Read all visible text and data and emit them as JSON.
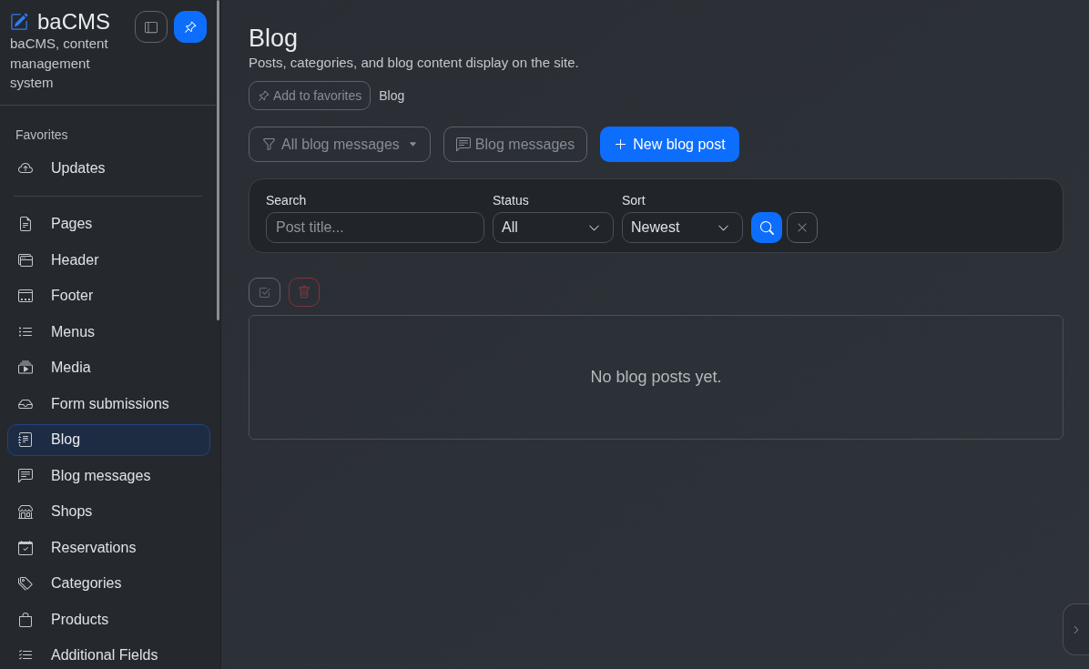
{
  "sidebar": {
    "brand": {
      "name": "baCMS",
      "tagline": "baCMS, content management system"
    },
    "pinned": true,
    "favorites_label": "Favorites",
    "favorites": [
      {
        "label": "Updates",
        "selected": false
      }
    ],
    "items": [
      {
        "label": "Pages",
        "selected": false
      },
      {
        "label": "Header",
        "selected": false
      },
      {
        "label": "Footer",
        "selected": false
      },
      {
        "label": "Menus",
        "selected": false
      },
      {
        "label": "Media",
        "selected": false
      },
      {
        "label": "Form submissions",
        "selected": false
      },
      {
        "label": "Blog",
        "selected": true
      },
      {
        "label": "Blog messages",
        "selected": false
      },
      {
        "label": "Shops",
        "selected": false
      },
      {
        "label": "Reservations",
        "selected": false
      },
      {
        "label": "Categories",
        "selected": false
      },
      {
        "label": "Products",
        "selected": false
      },
      {
        "label": "Additional Fields",
        "selected": false
      }
    ]
  },
  "page": {
    "title": "Blog",
    "subtitle": "Posts, categories, and blog content display on the site.",
    "favorite_button": "Add to favorites",
    "breadcrumb": [
      "Blog"
    ]
  },
  "toolbar": [
    {
      "kind": "dropdown",
      "label": "All blog messages"
    },
    {
      "kind": "outline",
      "label": "Blog messages"
    },
    {
      "kind": "primary",
      "label": "New blog post"
    }
  ],
  "filters": {
    "fields": [
      {
        "kind": "text",
        "label": "Search",
        "placeholder": "Post title..."
      },
      {
        "kind": "select",
        "label": "Status",
        "value": "All"
      },
      {
        "kind": "select",
        "label": "Sort",
        "value": "Newest"
      }
    ]
  },
  "bulk_actions": [
    {
      "kind": "select",
      "disabled": true
    },
    {
      "kind": "delete",
      "disabled": true
    }
  ],
  "empty_state": "No blog posts yet."
}
